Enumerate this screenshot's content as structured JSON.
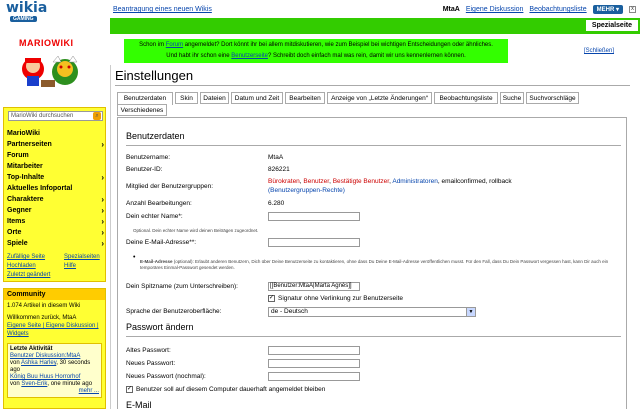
{
  "top": {
    "logo_text": "wikia",
    "logo_badge": "GAMING",
    "new_wiki_link": "Beantragung eines neuen Wikis",
    "user": "MtaA",
    "discussion": "Eigene Diskussion",
    "watchlist": "Beobachtungsliste",
    "more": "MEHR",
    "close": "x"
  },
  "greenbar": {
    "special_label": "Spezialseite"
  },
  "notice": {
    "l1_pre": "Schon im ",
    "l1_link": "Forum",
    "l1_post": " angemeldet? Dort könnt ihr bei allem mitdiskutieren, wie zum Beispiel bei wichtigen Entscheidungen oder ähnliches.",
    "l2_pre": "Und habt ihr schon eine ",
    "l2_link": "Benutzerseite",
    "l2_post": "? Schreibt doch einfach mal was rein, damit wir uns kennenlernen können.",
    "close": "[Schließen]"
  },
  "sidebar": {
    "wiki_title": "MARIOWIKI",
    "search_placeholder": "MarioWiki durchsuchen",
    "items": [
      {
        "label": "MarioWiki",
        "chevron": false
      },
      {
        "label": "Partnerseiten",
        "chevron": true
      },
      {
        "label": "Forum",
        "chevron": false
      },
      {
        "label": "Mitarbeiter",
        "chevron": false
      },
      {
        "label": "Top-Inhalte",
        "chevron": true
      },
      {
        "label": "Aktuelles Infoportal",
        "chevron": false
      },
      {
        "label": "Charaktere",
        "chevron": true
      },
      {
        "label": "Gegner",
        "chevron": true
      },
      {
        "label": "Items",
        "chevron": true
      },
      {
        "label": "Orte",
        "chevron": true
      },
      {
        "label": "Spiele",
        "chevron": true
      }
    ],
    "links": {
      "random": "Zufällige Seite",
      "special": "Spezialseiten",
      "upload": "Hochladen",
      "help": "Hilfe",
      "recent": "Zuletzt geändert"
    },
    "community": {
      "header": "Community",
      "articles": "1.074 Artikel in diesem Wiki",
      "welcome": "Willkommen zurück, MtaA",
      "user_links": "Eigene Seite | Eigene Diskussion | Widgets",
      "activity_title": "Letzte Aktivität",
      "a1_title": "Benutzer Diskussion:MtaA",
      "a1_meta_pre": "von ",
      "a1_user": "Ashka Harley",
      "a1_time": ", 30 seconds ago",
      "a2_title": "König Buu Huus Horrorhof",
      "a2_meta_pre": "von ",
      "a2_user": "Sven-Erik",
      "a2_time": ", one minute ago",
      "more": "mehr ..."
    }
  },
  "main": {
    "title": "Einstellungen",
    "tabs": [
      "Benutzerdaten",
      "Skin",
      "Dateien",
      "Datum und Zeit",
      "Bearbeiten",
      "Anzeige von „Letzte Änderungen“",
      "Beobachtungsliste",
      "Suche",
      "Suchvorschläge",
      "Verschiedenes"
    ],
    "section1": "Benutzerdaten",
    "username_label": "Benutzername:",
    "username": "MtaA",
    "userid_label": "Benutzer-ID:",
    "userid": "826221",
    "groups_label": "Mitglied der Benutzergruppen:",
    "groups": {
      "g1": "Bürokraten",
      "g2": "Benutzer",
      "g3": "Bestätigte Benutzer",
      "g4": "Administratoren",
      "rest": ", emailconfirmed, rollback",
      "rights": "(Benutzergruppen-Rechte)"
    },
    "edits_label": "Anzahl Bearbeitungen:",
    "edits": "6.280",
    "realname_label": "Dein echter Name*:",
    "realname_value": "",
    "realname_note": "Optional. Dein echter Name wird deinen Beiträgen zugeordnet.",
    "email_label": "Deine E-Mail-Adresse**:",
    "email_value": "",
    "email_note_b": "E-Mail-Adresse",
    "email_note": " (optional): Erlaubt anderen Benutzern, Dich über Deine Benutzerseite zu kontaktieren, ohne dass Du Deine E-Mail-Adresse veröffentlichen musst. Für den Fall, dass Du Dein Passwort vergessen hast, kann Dir auch ein temporäres Einmal-Passwort gesendet werden.",
    "nick_label": "Dein Spitzname (zum Unterschreiben):",
    "nick_value": "[[Benutzer:MtaA|Marta Agnès]]",
    "sig_label": "Signatur ohne Verlinkung zur Benutzerseite",
    "lang_label": "Sprache der Benutzeroberfläche:",
    "lang_value": "de - Deutsch",
    "section2": "Passwort ändern",
    "oldpw_label": "Altes Passwort:",
    "newpw_label": "Neues Passwort:",
    "newpw2_label": "Neues Passwort (nochmal):",
    "remember_label": "Benutzer soll auf diesem Computer dauerhaft angemeldet bleiben",
    "section3": "E-Mail"
  }
}
